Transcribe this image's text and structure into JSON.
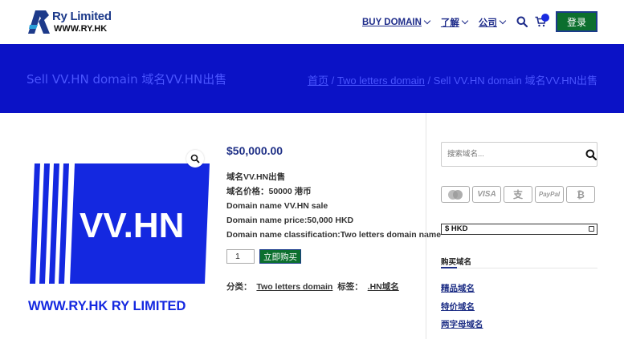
{
  "header": {
    "logo_title": "Ry Limited",
    "logo_sub": "WWW.RY.HK",
    "nav": [
      {
        "label": "BUY DOMAIN"
      },
      {
        "label": "了解"
      },
      {
        "label": "公司"
      }
    ],
    "login_label": "登录"
  },
  "banner": {
    "title": "Sell VV.HN domain 域名VV.HN出售",
    "breadcrumb": {
      "home": "首页",
      "sep": " / ",
      "category": "Two letters domain",
      "current": "Sell VV.HN domain 域名VV.HN出售"
    }
  },
  "product": {
    "image_text_main": "VV.HN",
    "image_text_footer": "WWW.RY.HK RY LIMITED",
    "price": "$50,000.00",
    "description": [
      "域名VV.HN出售",
      "域名价格：50000 港币",
      "Domain name VV.HN sale",
      "Domain name price:50,000 HKD",
      "Domain name classification:Two letters domain name"
    ],
    "quantity": "1",
    "buy_label": "立即购买",
    "meta": {
      "category_label": "分类：",
      "category": "Two letters domain",
      "tag_label": "标签：",
      "tag": ".HN域名"
    }
  },
  "sidebar": {
    "search_placeholder": "搜索域名...",
    "payments": [
      {
        "name": "mastercard-icon",
        "label": ""
      },
      {
        "name": "visa-icon",
        "label": "VISA"
      },
      {
        "name": "alipay-icon",
        "label": "支"
      },
      {
        "name": "paypal-icon",
        "label": "PayPal"
      },
      {
        "name": "bitcoin-icon",
        "label": "₿"
      }
    ],
    "currency": "$ HKD",
    "widget_title": "购买域名",
    "links": [
      "精品域名",
      "特价域名",
      "两字母域名"
    ]
  },
  "colors": {
    "brand_blue": "#0b12c6",
    "nav_blue": "#1d2b8a",
    "button_green": "#0c6f2e"
  }
}
